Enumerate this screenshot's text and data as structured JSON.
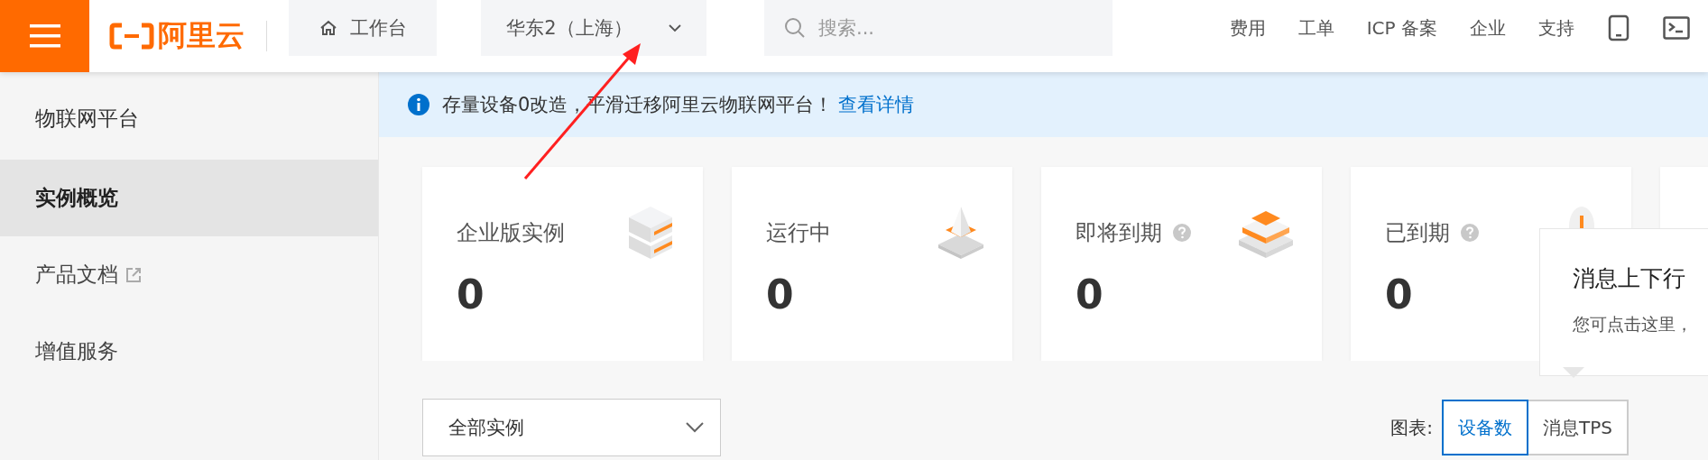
{
  "header": {
    "logo": "阿里云",
    "workbench": "工作台",
    "region": "华东2（上海）",
    "search": {
      "placeholder": "搜索..."
    },
    "nav": [
      "费用",
      "工单",
      "ICP 备案",
      "企业",
      "支持"
    ]
  },
  "sidebar": {
    "title": "物联网平台",
    "items": [
      {
        "label": "实例概览",
        "selected": true,
        "external": false
      },
      {
        "label": "产品文档",
        "selected": false,
        "external": true
      },
      {
        "label": "增值服务",
        "selected": false,
        "external": false
      }
    ]
  },
  "banner": {
    "text": "存量设备0改造，平滑迁移阿里云物联网平台！",
    "link": "查看详情"
  },
  "cards": [
    {
      "label": "企业版实例",
      "value": "0",
      "help": false,
      "kind": "server"
    },
    {
      "label": "运行中",
      "value": "0",
      "help": false,
      "kind": "pyramid"
    },
    {
      "label": "即将到期",
      "value": "0",
      "help": true,
      "kind": "notebook"
    },
    {
      "label": "已到期",
      "value": "0",
      "help": true,
      "kind": "alert"
    }
  ],
  "instance_select": {
    "value": "全部实例"
  },
  "chart_toggle": {
    "label": "图表:",
    "options": [
      {
        "label": "设备数",
        "selected": true
      },
      {
        "label": "消息TPS",
        "selected": false
      }
    ]
  },
  "popover": {
    "title": "消息上下行",
    "text": "您可点击这里，"
  }
}
